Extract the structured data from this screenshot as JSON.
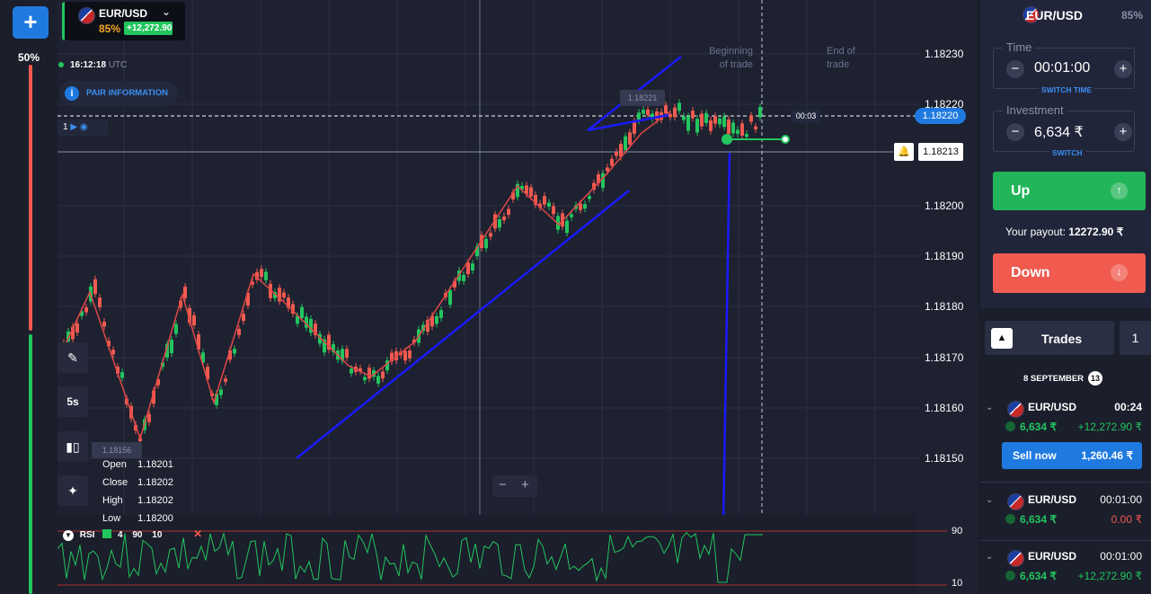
{
  "toolbar": {
    "add_label": "+"
  },
  "sentiment": {
    "pct": "50%",
    "up_fraction": 0.5
  },
  "pair": {
    "name": "EUR/USD",
    "payout_pct": "85%",
    "gain": "+12,272.90"
  },
  "clock": {
    "time": "16:12:18",
    "tz": "UTC"
  },
  "pair_info": {
    "label": "PAIR INFORMATION",
    "icon": "info-icon"
  },
  "indicator_row": {
    "count": "1"
  },
  "tools": {
    "draw_icon": "pencil-icon",
    "timeframe": "5s",
    "chart_type_icon": "candles-icon",
    "indicators_icon": "satellite-icon"
  },
  "ohlc": {
    "open_label": "Open",
    "open": "1.18201",
    "close_label": "Close",
    "close": "1.18202",
    "high_label": "High",
    "high": "1.18202",
    "low_label": "Low",
    "low": "1.18200"
  },
  "zoom": {
    "minus": "−",
    "plus": "+"
  },
  "price_axis": [
    "1.18230",
    "1.18220",
    "1.18200",
    "1.18190",
    "1.18180",
    "1.18170",
    "1.18160",
    "1.18150"
  ],
  "current_price": "1.18220",
  "line_price": "1.18213",
  "timer": "00:03",
  "high_marker": "1.18221",
  "low_marker": "1.18156",
  "annotations": {
    "begin": "Beginning of trade",
    "end": "End of trade"
  },
  "rsi": {
    "label": "RSI",
    "period": "4",
    "upper": "90",
    "lower": "10",
    "extra": "10",
    "level_top": "90",
    "level_bottom": "10"
  },
  "panel": {
    "asset": "EUR/USD",
    "payout_pct": "85%",
    "time_label": "Time",
    "time_value": "00:01:00",
    "switch_time": "SWITCH TIME",
    "investment_label": "Investment",
    "investment_value": "6,634 ₹",
    "switch": "SWITCH",
    "up_label": "Up",
    "down_label": "Down",
    "payout_label": "Your payout:",
    "payout_value": "12272.90 ₹"
  },
  "trades": {
    "title": "Trades",
    "count": "1",
    "date": "8 SEPTEMBER",
    "date_count": "13",
    "items": [
      {
        "pair": "EUR/USD",
        "time": "00:24",
        "amount": "6,634 ₹",
        "result": "+12,272.90 ₹"
      },
      {
        "pair": "EUR/USD",
        "time": "00:01:00",
        "amount": "6,634 ₹",
        "result": "0.00 ₹"
      },
      {
        "pair": "EUR/USD",
        "time": "00:01:00",
        "amount": "6,634 ₹",
        "result": "+12,272.90 ₹"
      }
    ],
    "sell_now": "Sell now",
    "sell_value": "1,260.46 ₹"
  },
  "colors": {
    "up": "#22b559",
    "down": "#f05a4f",
    "accent": "#1f7ae0",
    "bg": "#1e2130"
  }
}
